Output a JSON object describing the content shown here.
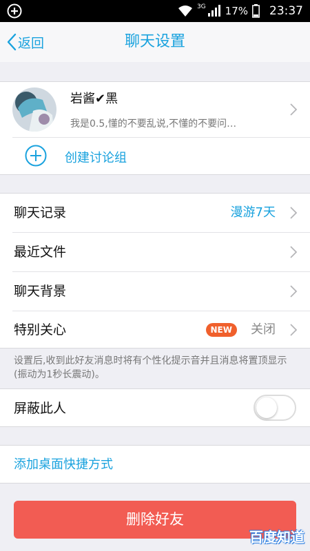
{
  "statusbar": {
    "network": "3G",
    "battery": "17%",
    "time": "23:37"
  },
  "navbar": {
    "back_label": "返回",
    "title": "聊天设置"
  },
  "profile": {
    "name": "岩酱✔黑",
    "signature": "我是0.5,懂的不要乱说,不懂的不要问…",
    "create_group_label": "创建讨论组"
  },
  "settings": {
    "chat_history": {
      "label": "聊天记录",
      "value": "漫游7天"
    },
    "recent_files": {
      "label": "最近文件"
    },
    "chat_background": {
      "label": "聊天背景"
    },
    "special_care": {
      "label": "特别关心",
      "badge": "NEW",
      "value": "关闭"
    }
  },
  "note": "设置后,收到此好友消息时将有个性化提示音并且消息将置顶显示(振动为1秒长震动)。",
  "block": {
    "label": "屏蔽此人",
    "enabled": false
  },
  "shortcut_label": "添加桌面快捷方式",
  "delete_button": "删除好友",
  "watermark": "百度知道",
  "colors": {
    "accent": "#19a2de",
    "danger": "#f25c53",
    "badge": "#f0602c"
  }
}
